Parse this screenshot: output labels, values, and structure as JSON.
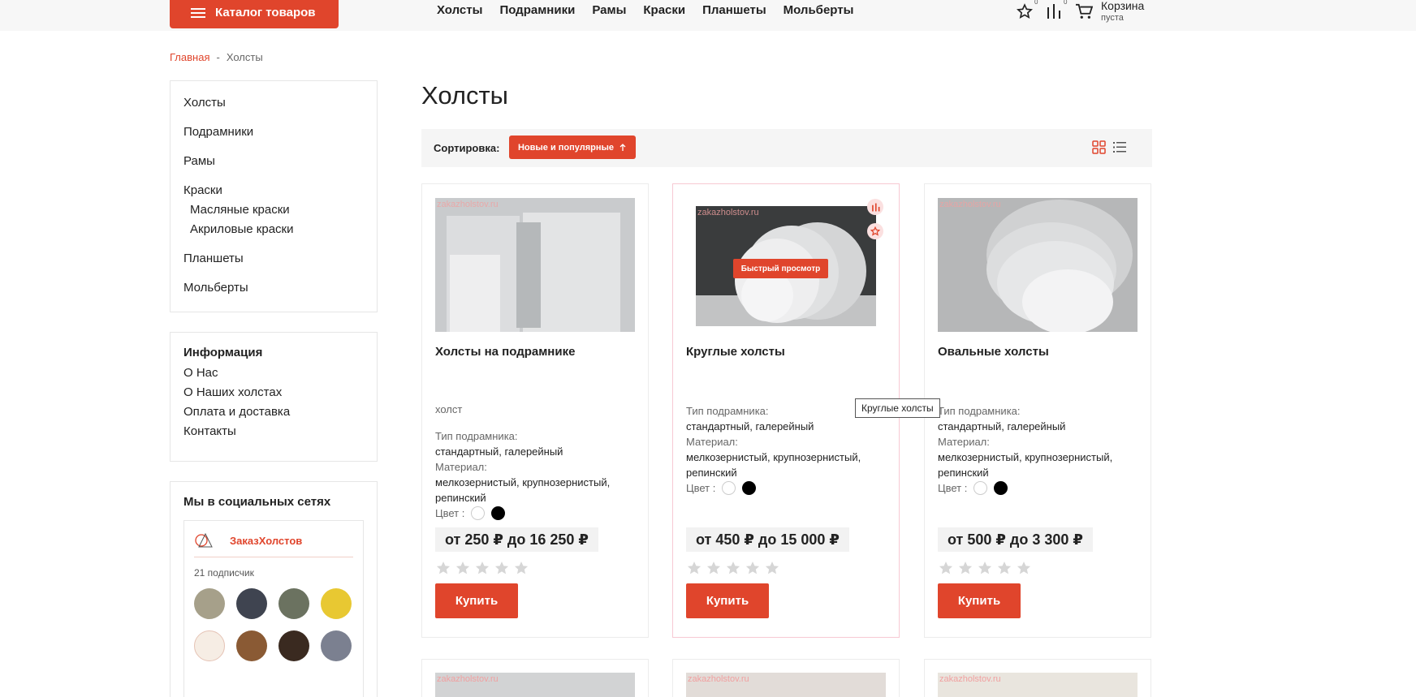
{
  "header": {
    "catalog_label": "Каталог товаров",
    "nav": [
      "Холсты",
      "Подрамники",
      "Рамы",
      "Краски",
      "Планшеты",
      "Мольберты"
    ],
    "favorites_count": "0",
    "compare_count": "0",
    "cart_title": "Корзина",
    "cart_status": "пуста"
  },
  "breadcrumb": {
    "home": "Главная",
    "sep": "-",
    "current": "Холсты"
  },
  "sidebar": {
    "categories": [
      "Холсты",
      "Подрамники",
      "Рамы",
      "Краски",
      "Масляные краски",
      "Акриловые краски",
      "Планшеты",
      "Мольберты"
    ],
    "info_title": "Информация",
    "info_links": [
      "О Нас",
      "О Наших холстах",
      "Оплата и доставка",
      "Контакты"
    ],
    "social_title": "Мы в социальных сетях",
    "vk_name": "ЗаказХолстов",
    "vk_subs": "21 подписчик"
  },
  "main": {
    "title": "Холсты",
    "sort_label": "Сортировка:",
    "sort_value": "Новые и популярные",
    "watermark": "zakazholstov.ru",
    "quick_view": "Быстрый просмотр",
    "tooltip": "Круглые холсты",
    "products": [
      {
        "name": "Холсты на подрамнике",
        "tag": "холст",
        "frame_label": "Тип подрамника:",
        "frame_value": "стандартный, галерейный",
        "material_label": "Материал:",
        "material_value": "мелкозернистый, крупнозернистый, репинский",
        "color_label": "Цвет :",
        "price": "от 250 ₽ до 16 250 ₽",
        "buy": "Купить"
      },
      {
        "name": "Круглые холсты",
        "frame_label": "Тип подрамника:",
        "frame_value": "стандартный, галерейный",
        "material_label": "Материал:",
        "material_value": "мелкозернистый, крупнозернистый, репинский",
        "color_label": "Цвет :",
        "price": "от 450 ₽ до 15 000 ₽",
        "buy": "Купить"
      },
      {
        "name": "Овальные холсты",
        "frame_label": "Тип подрамника:",
        "frame_value": "стандартный, галерейный",
        "material_label": "Материал:",
        "material_value": "мелкозернистый, крупнозернистый, репинский",
        "color_label": "Цвет :",
        "price": "от 500 ₽ до 3 300 ₽",
        "buy": "Купить"
      }
    ]
  },
  "colors": {
    "accent": "#e0452c",
    "border": "#e6e6e6",
    "header_bg": "#f7f7f7"
  }
}
